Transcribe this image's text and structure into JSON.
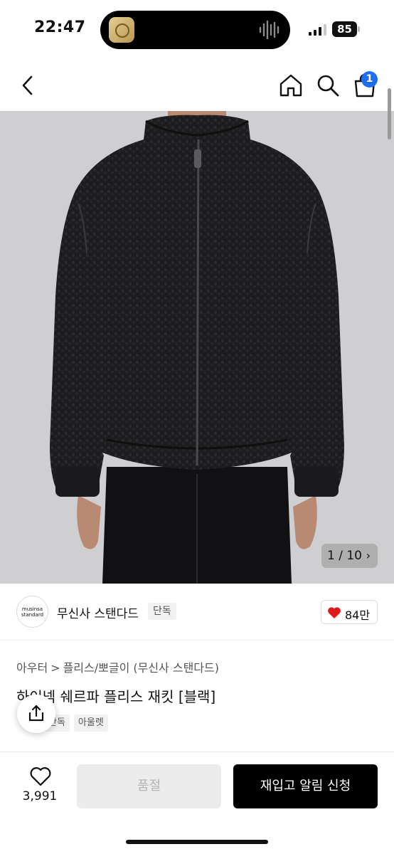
{
  "status": {
    "time": "22:47",
    "battery": "85"
  },
  "nav": {
    "cart_count": "1"
  },
  "gallery": {
    "counter": "1 / 10",
    "next": "›"
  },
  "brand": {
    "logo_line1": "musinsa",
    "logo_line2": "standard",
    "name": "무신사 스탠다드",
    "tag": "단독",
    "likes": "84만"
  },
  "product": {
    "breadcrumb": [
      "아우터",
      "플리스/뽀글이 (무신사 스탠다드)"
    ],
    "breadcrumb_sep": ">",
    "title": "하이넥 쉐르파 플리스 재킷 [블랙]",
    "tags": [
      "단독",
      "아울렛"
    ]
  },
  "bottom": {
    "wish_count": "3,991",
    "soldout_label": "품절",
    "restock_label": "재입고 알림 신청"
  },
  "colors": {
    "accent_blue": "#1f6df2",
    "heart_red": "#e0191b",
    "primary_black": "#000000"
  }
}
